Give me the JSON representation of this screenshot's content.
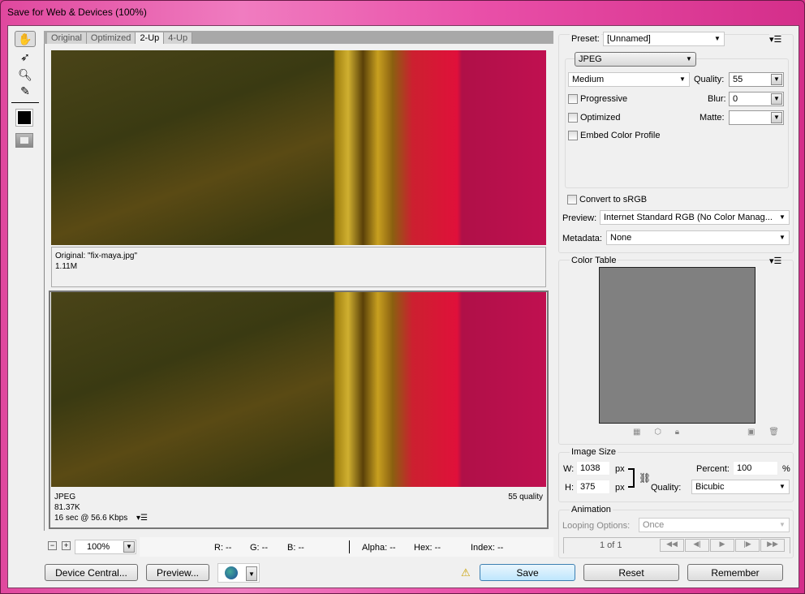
{
  "window": {
    "title": "Save for Web & Devices (100%)"
  },
  "tools": [
    "hand-tool",
    "slice-select-tool",
    "zoom-tool",
    "eyedropper-tool",
    "eyedropper-color",
    "toggle-slices"
  ],
  "tabs": [
    {
      "label": "Original"
    },
    {
      "label": "Optimized"
    },
    {
      "label": "2-Up",
      "active": true
    },
    {
      "label": "4-Up"
    }
  ],
  "original": {
    "name": "Original: \"fix-maya.jpg\"",
    "size": "1.11M"
  },
  "optimized": {
    "format": "JPEG",
    "size": "81.37K",
    "time": "16 sec @ 56.6 Kbps",
    "quality": "55 quality"
  },
  "status": {
    "zoom": "100%",
    "r": "R: --",
    "g": "G: --",
    "b": "B: --",
    "alpha": "Alpha: --",
    "hex": "Hex: --",
    "index": "Index: --"
  },
  "buttons": {
    "device_central": "Device Central...",
    "preview": "Preview...",
    "save": "Save",
    "reset": "Reset",
    "remember": "Remember"
  },
  "settings": {
    "preset_label": "Preset:",
    "preset": "[Unnamed]",
    "format": "JPEG",
    "compression": "Medium",
    "quality_label": "Quality:",
    "quality": "55",
    "blur_label": "Blur:",
    "blur": "0",
    "matte_label": "Matte:",
    "matte": "",
    "progressive": "Progressive",
    "optimized": "Optimized",
    "embed": "Embed Color Profile",
    "progressive_checked": false,
    "optimized_checked": false,
    "embed_checked": false,
    "convert": "Convert to sRGB",
    "convert_checked": false,
    "preview_label": "Preview:",
    "preview": "Internet Standard RGB (No Color Manag...",
    "metadata_label": "Metadata:",
    "metadata": "None"
  },
  "color_table": {
    "title": "Color Table",
    "swatch": "#808080"
  },
  "image_size": {
    "title": "Image Size",
    "w_label": "W:",
    "w": "1038",
    "h_label": "H:",
    "h": "375",
    "unit": "px",
    "percent_label": "Percent:",
    "percent": "100",
    "percent_unit": "%",
    "quality_label": "Quality:",
    "quality": "Bicubic"
  },
  "animation": {
    "title": "Animation",
    "looping_label": "Looping Options:",
    "looping": "Once",
    "frame": "1 of 1"
  }
}
